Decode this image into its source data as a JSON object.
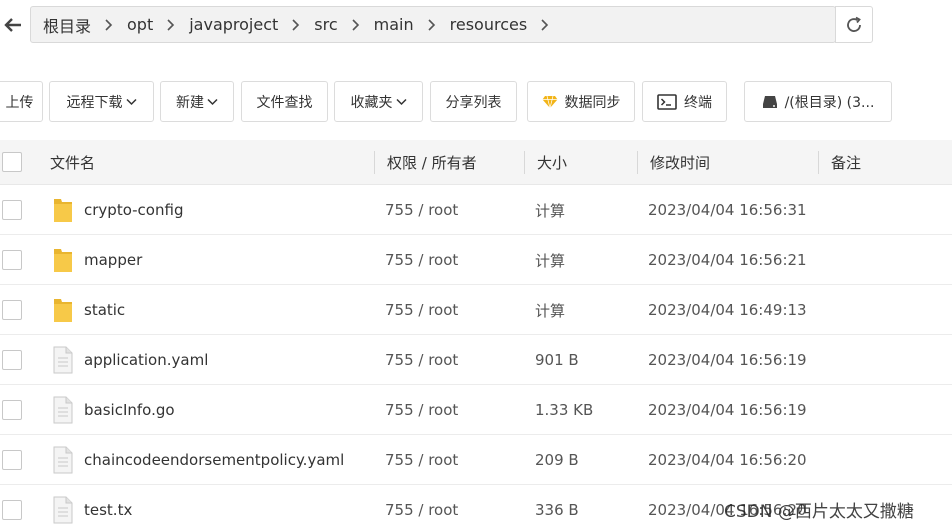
{
  "breadcrumb": {
    "items": [
      "根目录",
      "opt",
      "javaproject",
      "src",
      "main",
      "resources"
    ]
  },
  "toolbar": {
    "upload": "上传",
    "remote_download": "远程下载",
    "new": "新建",
    "file_search": "文件查找",
    "favorites": "收藏夹",
    "share_list": "分享列表",
    "data_sync": "数据同步",
    "terminal": "终端",
    "disk": "/(根目录) (3..."
  },
  "table": {
    "headers": {
      "name": "文件名",
      "perm": "权限 / 所有者",
      "size": "大小",
      "mtime": "修改时间",
      "note": "备注"
    },
    "rows": [
      {
        "name": "crypto-config",
        "type": "folder",
        "perm": "755 / root",
        "size": "计算",
        "mtime": "2023/04/04 16:56:31"
      },
      {
        "name": "mapper",
        "type": "folder",
        "perm": "755 / root",
        "size": "计算",
        "mtime": "2023/04/04 16:56:21"
      },
      {
        "name": "static",
        "type": "folder",
        "perm": "755 / root",
        "size": "计算",
        "mtime": "2023/04/04 16:49:13"
      },
      {
        "name": "application.yaml",
        "type": "file",
        "perm": "755 / root",
        "size": "901 B",
        "mtime": "2023/04/04 16:56:19"
      },
      {
        "name": "basicInfo.go",
        "type": "file",
        "perm": "755 / root",
        "size": "1.33 KB",
        "mtime": "2023/04/04 16:56:19"
      },
      {
        "name": "chaincodeendorsementpolicy.yaml",
        "type": "file",
        "perm": "755 / root",
        "size": "209 B",
        "mtime": "2023/04/04 16:56:20"
      },
      {
        "name": "test.tx",
        "type": "file",
        "perm": "755 / root",
        "size": "336 B",
        "mtime": "2023/04/04 16:56:20"
      }
    ]
  },
  "watermark": "CSDN @西片太太又撒糖",
  "colors": {
    "calc_green": "#1a8a3a",
    "folder_yellow": "#f7c948",
    "gem_yellow": "#f2b418"
  }
}
